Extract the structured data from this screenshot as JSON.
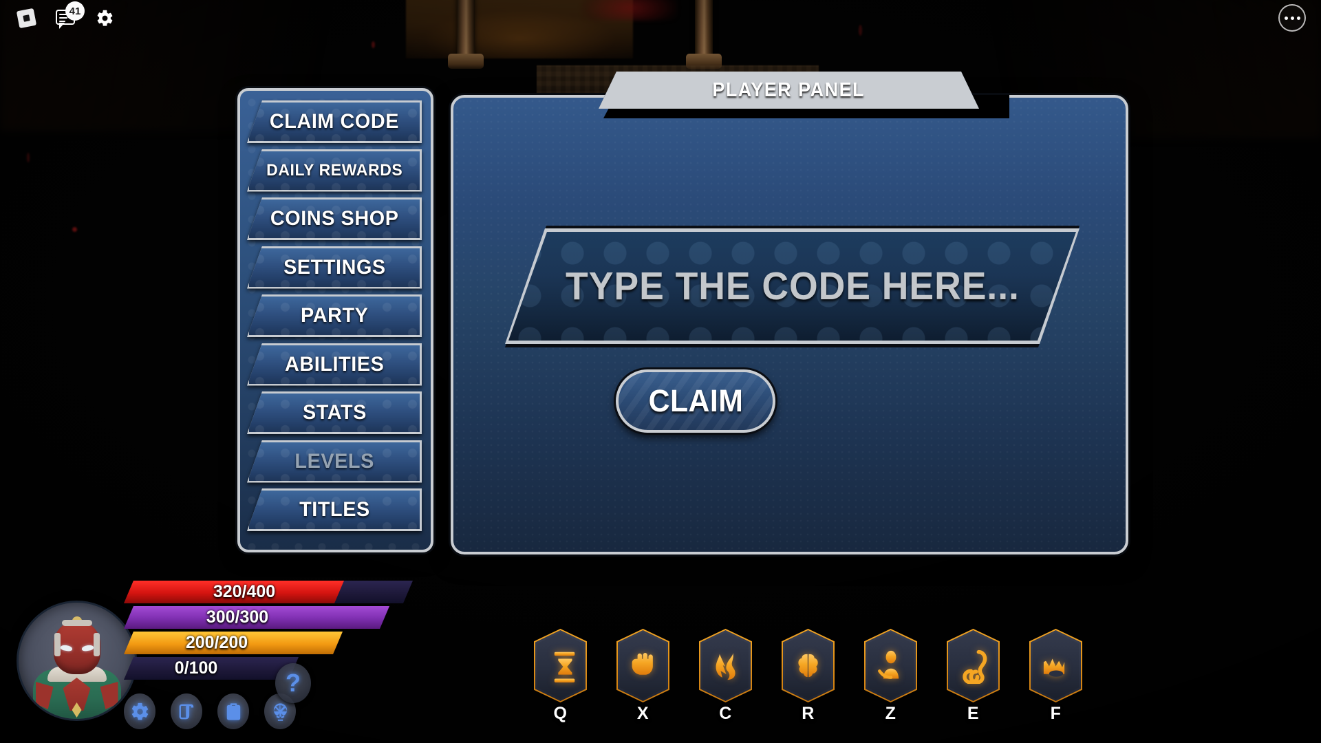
{
  "roblox_topbar": {
    "logo_icon": "roblox-logo-icon",
    "chat_icon": "chat-icon",
    "chat_badge_count": "41",
    "settings_icon": "gear-icon",
    "more_icon": "ellipsis-icon"
  },
  "menu": {
    "items": [
      {
        "label": "CLAIM CODE",
        "state": "active",
        "size": "normal"
      },
      {
        "label": "DAILY REWARDS",
        "state": "normal",
        "size": "small"
      },
      {
        "label": "COINS SHOP",
        "state": "normal",
        "size": "normal"
      },
      {
        "label": "SETTINGS",
        "state": "normal",
        "size": "normal"
      },
      {
        "label": "PARTY",
        "state": "normal",
        "size": "normal"
      },
      {
        "label": "ABILITIES",
        "state": "normal",
        "size": "normal"
      },
      {
        "label": "STATS",
        "state": "normal",
        "size": "normal"
      },
      {
        "label": "LEVELS",
        "state": "disabled",
        "size": "normal"
      },
      {
        "label": "TITLES",
        "state": "normal",
        "size": "normal"
      }
    ]
  },
  "panel": {
    "title": "PLAYER PANEL",
    "code_input_placeholder": "TYPE THE CODE HERE...",
    "code_input_value": "",
    "claim_label": "CLAIM"
  },
  "hud": {
    "avatar_name": "player-avatar",
    "bars": [
      {
        "name": "health",
        "text": "320/400",
        "current": 320,
        "max": 400,
        "color": "#d41410"
      },
      {
        "name": "mana",
        "text": "300/300",
        "current": 300,
        "max": 300,
        "color": "#7e2fb0"
      },
      {
        "name": "stamina",
        "text": "200/200",
        "current": 200,
        "max": 200,
        "color": "#f39a12"
      },
      {
        "name": "energy",
        "text": "0/100",
        "current": 0,
        "max": 100,
        "color": "#2b2550"
      }
    ],
    "buttons": [
      {
        "name": "settings-button",
        "icon": "gear-icon"
      },
      {
        "name": "quests-button",
        "icon": "scroll-icon"
      },
      {
        "name": "tasks-button",
        "icon": "clipboard-icon"
      },
      {
        "name": "spin-wheel-button",
        "icon": "wheel-icon"
      }
    ],
    "help_label": "?"
  },
  "hotbar": {
    "slots": [
      {
        "key": "Q",
        "icon": "hourglass-icon"
      },
      {
        "key": "X",
        "icon": "fist-icon"
      },
      {
        "key": "C",
        "icon": "flame-claw-icon"
      },
      {
        "key": "R",
        "icon": "brain-icon"
      },
      {
        "key": "Z",
        "icon": "person-icon"
      },
      {
        "key": "E",
        "icon": "hook-icon"
      },
      {
        "key": "F",
        "icon": "crown-fire-icon"
      }
    ]
  },
  "colors": {
    "panel_blue": "#284a77",
    "panel_border": "#c9cdd2",
    "accent_gold": "#f5a623",
    "hud_icon_blue": "#5b8fe8"
  }
}
